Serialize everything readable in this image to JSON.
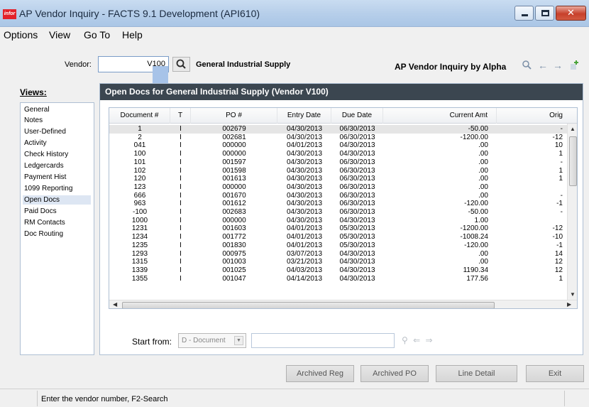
{
  "window": {
    "logo_text": "infor",
    "title": "AP Vendor Inquiry - FACTS 9.1 Development (API610)",
    "close_glyph": "✕"
  },
  "menu": [
    "Options",
    "View",
    "Go To",
    "Help"
  ],
  "vendor": {
    "label": "Vendor:",
    "value": "V100",
    "name": "General Industrial Supply",
    "inquiry_title": "AP Vendor Inquiry by Alpha"
  },
  "toolbar_icons": [
    "zoom-icon",
    "back-arrow-icon",
    "forward-arrow-icon",
    "add-icon"
  ],
  "views": {
    "label": "Views:",
    "selected": "Open Docs",
    "items": [
      "General",
      "Notes",
      "User-Defined",
      "Activity",
      "Check History",
      "Ledgercards",
      "Payment Hist",
      "1099 Reporting",
      "Open Docs",
      "Paid Docs",
      "RM Contacts",
      "Doc Routing"
    ]
  },
  "panel": {
    "header": "Open Docs for General Industrial Supply (Vendor V100)"
  },
  "grid": {
    "columns": [
      "Document #",
      "T",
      "PO #",
      "Entry Date",
      "Due Date",
      "Current Amt",
      "Orig"
    ],
    "rows": [
      [
        "1",
        "I",
        "002679",
        "04/30/2013",
        "06/30/2013",
        "-50.00",
        "-"
      ],
      [
        "2",
        "I",
        "002681",
        "04/30/2013",
        "06/30/2013",
        "-1200.00",
        "-12"
      ],
      [
        "041",
        "I",
        "000000",
        "04/01/2013",
        "04/30/2013",
        ".00",
        "10"
      ],
      [
        "100",
        "I",
        "000000",
        "04/30/2013",
        "04/30/2013",
        ".00",
        "1"
      ],
      [
        "101",
        "I",
        "001597",
        "04/30/2013",
        "06/30/2013",
        ".00",
        "-"
      ],
      [
        "102",
        "I",
        "001598",
        "04/30/2013",
        "06/30/2013",
        ".00",
        "1"
      ],
      [
        "120",
        "I",
        "001613",
        "04/30/2013",
        "06/30/2013",
        ".00",
        "1"
      ],
      [
        "123",
        "I",
        "000000",
        "04/30/2013",
        "06/30/2013",
        ".00",
        ""
      ],
      [
        "666",
        "I",
        "001670",
        "04/30/2013",
        "06/30/2013",
        ".00",
        "-"
      ],
      [
        "963",
        "I",
        "001612",
        "04/30/2013",
        "06/30/2013",
        "-120.00",
        "-1"
      ],
      [
        "-100",
        "I",
        "002683",
        "04/30/2013",
        "06/30/2013",
        "-50.00",
        "-"
      ],
      [
        "1000",
        "I",
        "000000",
        "04/30/2013",
        "04/30/2013",
        "1.00",
        ""
      ],
      [
        "1231",
        "I",
        "001603",
        "04/01/2013",
        "05/30/2013",
        "-1200.00",
        "-12"
      ],
      [
        "1234",
        "I",
        "001772",
        "04/01/2013",
        "05/30/2013",
        "-1008.24",
        "-10"
      ],
      [
        "1235",
        "I",
        "001830",
        "04/01/2013",
        "05/30/2013",
        "-120.00",
        "-1"
      ],
      [
        "1293",
        "I",
        "000975",
        "03/07/2013",
        "04/30/2013",
        ".00",
        "14"
      ],
      [
        "1315",
        "I",
        "001003",
        "03/21/2013",
        "04/30/2013",
        ".00",
        "12"
      ],
      [
        "1339",
        "I",
        "001025",
        "04/03/2013",
        "04/30/2013",
        "1190.34",
        "12"
      ],
      [
        "1355",
        "I",
        "001047",
        "04/14/2013",
        "04/30/2013",
        "177.56",
        "1"
      ]
    ]
  },
  "start_from": {
    "label": "Start from:",
    "selected_option": "D - Document",
    "value": ""
  },
  "buttons": {
    "archived_reg": "Archived Reg",
    "archived_po": "Archived PO",
    "line_detail": "Line Detail",
    "exit": "Exit"
  },
  "status": {
    "message": "Enter the vendor number, F2-Search"
  }
}
